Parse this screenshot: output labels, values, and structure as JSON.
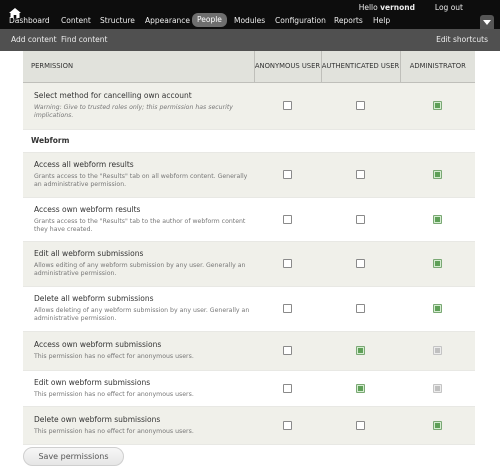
{
  "toolbar": {
    "menu": [
      "Dashboard",
      "Content",
      "Structure",
      "Appearance",
      "People",
      "Modules",
      "Configuration",
      "Reports",
      "Help"
    ],
    "active_item": "People",
    "greeting_prefix": "Hello ",
    "user_name": "vernond",
    "logout": "Log out"
  },
  "shortcuts": {
    "items": [
      "Add content",
      "Find content"
    ],
    "edit": "Edit shortcuts"
  },
  "table": {
    "headers": {
      "permission": "PERMISSION",
      "anonymous": "ANONYMOUS USER",
      "authenticated": "AUTHENTICATED USER",
      "administrator": "ADMINISTRATOR"
    },
    "top_row": {
      "title": "Select method for cancelling own account",
      "warning": "Warning: Give to trusted roles only; this permission has security implications.",
      "anonymous": "unchecked",
      "authenticated": "unchecked",
      "administrator": "checked"
    },
    "module_title": "Webform",
    "rows": [
      {
        "title": "Access all webform results",
        "desc": "Grants access to the \"Results\" tab on all webform content. Generally an administrative permission.",
        "anonymous": "unchecked",
        "authenticated": "unchecked",
        "administrator": "checked"
      },
      {
        "title": "Access own webform results",
        "desc": "Grants access to the \"Results\" tab to the author of webform content they have created.",
        "anonymous": "unchecked",
        "authenticated": "unchecked",
        "administrator": "checked"
      },
      {
        "title": "Edit all webform submissions",
        "desc": "Allows editing of any webform submission by any user. Generally an administrative permission.",
        "anonymous": "unchecked",
        "authenticated": "unchecked",
        "administrator": "checked"
      },
      {
        "title": "Delete all webform submissions",
        "desc": "Allows deleting of any webform submission by any user. Generally an administrative permission.",
        "anonymous": "unchecked",
        "authenticated": "unchecked",
        "administrator": "checked"
      },
      {
        "title": "Access own webform submissions",
        "desc": "This permission has no effect for anonymous users.",
        "anonymous": "unchecked",
        "authenticated": "checked",
        "administrator": "disabled"
      },
      {
        "title": "Edit own webform submissions",
        "desc": "This permission has no effect for anonymous users.",
        "anonymous": "unchecked",
        "authenticated": "checked",
        "administrator": "disabled"
      },
      {
        "title": "Delete own webform submissions",
        "desc": "This permission has no effect for anonymous users.",
        "anonymous": "unchecked",
        "authenticated": "unchecked",
        "administrator": "checked"
      }
    ]
  },
  "save_button": "Save permissions",
  "colors": {
    "toolbar_bg": "#0d0d0d",
    "shortcuts_bg": "#505050",
    "header_bg": "#e1e2dc",
    "row_alt_bg": "#f0f0ea",
    "checked_green": "#5fa058"
  }
}
